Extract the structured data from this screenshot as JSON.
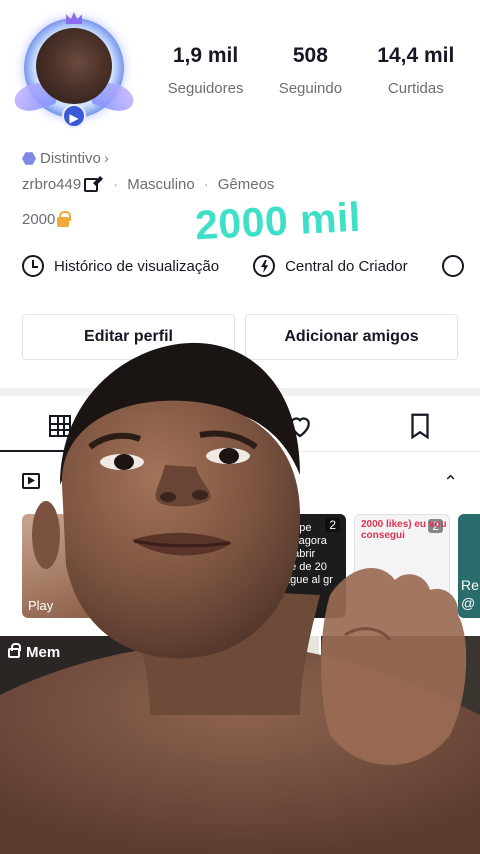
{
  "profile": {
    "followers_value": "1,9 mil",
    "followers_label": "Seguidores",
    "following_value": "508",
    "following_label": "Seguindo",
    "likes_value": "14,4 mil",
    "likes_label": "Curtidas",
    "badge_label": "Distintivo",
    "username": "zrbro449",
    "gender": "Masculino",
    "sign": "Gêmeos",
    "bio": "2000"
  },
  "overlay": {
    "text": "2000 mil",
    "color": "#3fe0c8"
  },
  "links": {
    "history_label": "Histórico de visualização",
    "creator_label": "Central do Criador"
  },
  "buttons": {
    "edit_label": "Editar perfil",
    "add_friends_label": "Adicionar amigos"
  },
  "tabs": {
    "icons": [
      "grid-icon",
      "heart-icon",
      "bookmark-icon"
    ]
  },
  "playlists": {
    "card1_label": "Play",
    "card2_text": "do pe\nas agora\na abrir\nde de 20\nague al gr",
    "card2_count": "2",
    "card3_text": "2000 likes) eu vou\nconsegui",
    "card3_count": "2",
    "card4_text": "Re\n@"
  },
  "videos": {
    "first_label": "Mem"
  }
}
